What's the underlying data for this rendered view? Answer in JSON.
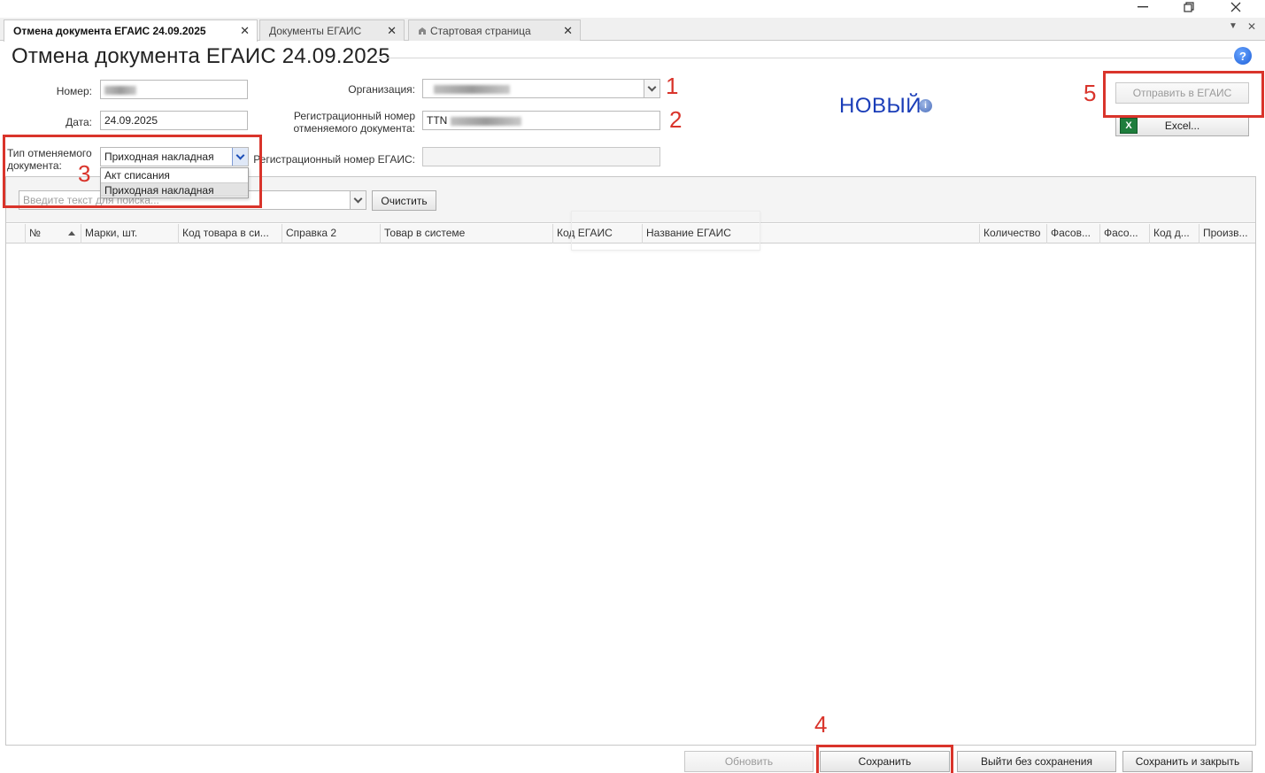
{
  "window": {
    "minimize_icon": "minimize-icon",
    "restore_icon": "restore-icon",
    "close_icon": "close-icon"
  },
  "tabs": [
    {
      "label": "Отмена документа ЕГАИС  24.09.2025",
      "active": true
    },
    {
      "label": "Документы ЕГАИС",
      "active": false
    },
    {
      "label": "Стартовая страница",
      "active": false,
      "icon": "home-icon"
    }
  ],
  "page": {
    "title": "Отмена документа ЕГАИС  24.09.2025",
    "status": "НОВЫЙ"
  },
  "form": {
    "number_label": "Номер:",
    "date_label": "Дата:",
    "date_value": "24.09.2025",
    "org_label": "Организация:",
    "reg_number_label_1": "Регистрационный номер",
    "reg_number_label_2": "отменяемого документа:",
    "reg_number_value": "TTN",
    "doc_type_label_1": "Тип отменяемого",
    "doc_type_label_2": "документа:",
    "doc_type_value": "Приходная накладная",
    "egais_reg_label": "Регистрационный номер ЕГАИС:",
    "egais_reg_value": ""
  },
  "doc_type_options": [
    "Акт списания",
    "Приходная накладная"
  ],
  "buttons": {
    "send_egais": "Отправить в ЕГАИС",
    "excel": "Excel...",
    "clear": "Очистить",
    "refresh": "Обновить",
    "save": "Сохранить",
    "exit_no_save": "Выйти без сохранения",
    "save_close": "Сохранить и закрыть"
  },
  "search": {
    "placeholder": "Введите текст для поиска..."
  },
  "columns": [
    "№",
    "Марки, шт.",
    "Код товара в си...",
    "Справка 2",
    "Товар в системе",
    "Код ЕГАИС",
    "Название ЕГАИС",
    "Количество",
    "Фасов...",
    "Фасо...",
    "Код д...",
    "Произв..."
  ],
  "annotations": [
    "1",
    "2",
    "3",
    "4",
    "5"
  ],
  "colors": {
    "annotation": "#d9342b",
    "status": "#1a3db8"
  }
}
